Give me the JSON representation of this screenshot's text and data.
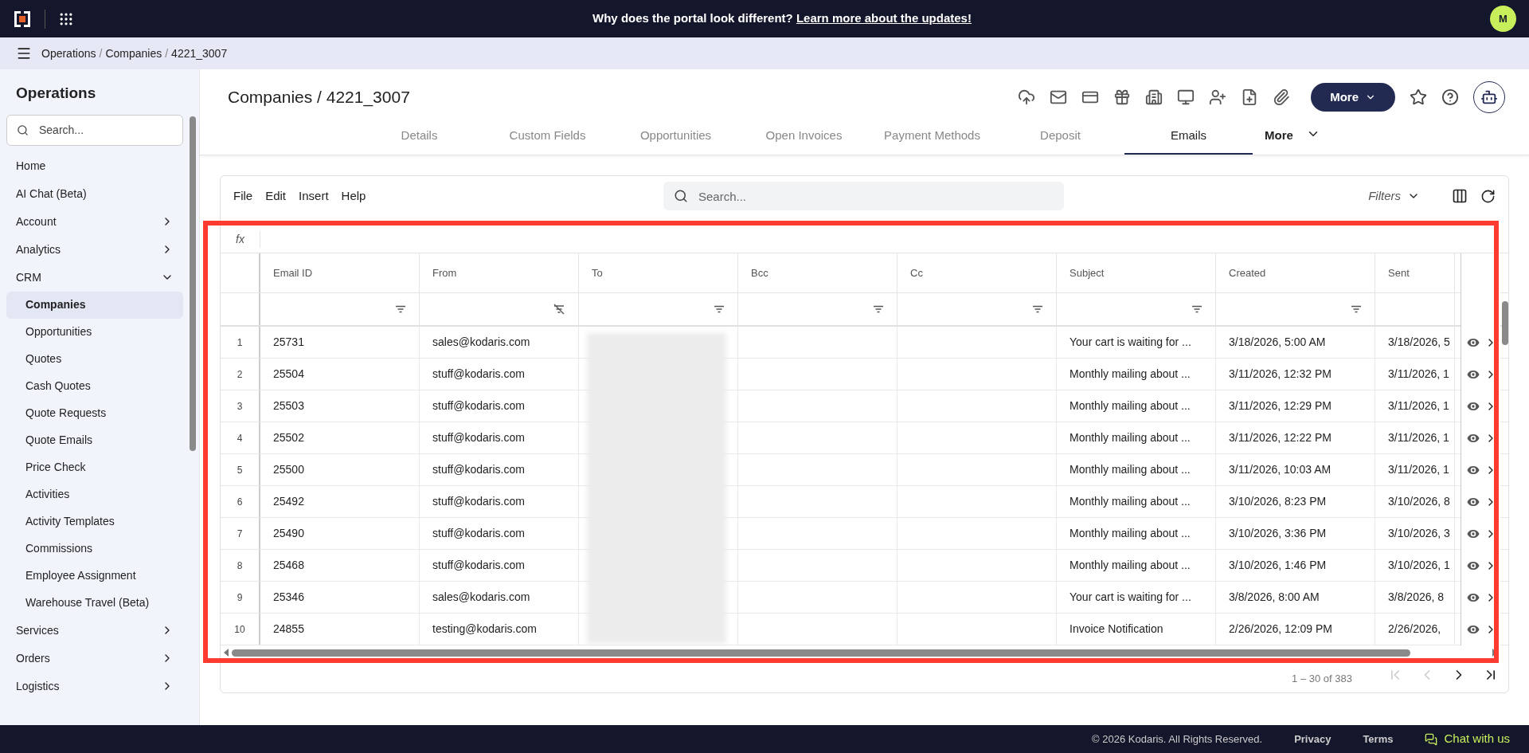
{
  "banner": {
    "text": "Why does the portal look different?",
    "link": "Learn more about the updates!",
    "avatar": "M"
  },
  "breadcrumb": {
    "separator": "/",
    "items": [
      "Operations",
      "Companies",
      "4221_3007"
    ]
  },
  "sidebar": {
    "title": "Operations",
    "search_placeholder": "Search...",
    "items": [
      {
        "label": "Home"
      },
      {
        "label": "AI Chat (Beta)"
      },
      {
        "label": "Account",
        "expanded": false
      },
      {
        "label": "Analytics",
        "expanded": false
      },
      {
        "label": "CRM",
        "expanded": true,
        "children": [
          {
            "label": "Companies",
            "selected": true
          },
          {
            "label": "Opportunities",
            "selected": false
          },
          {
            "label": "Quotes",
            "selected": false
          },
          {
            "label": "Cash Quotes",
            "selected": false
          },
          {
            "label": "Quote Requests",
            "selected": false
          },
          {
            "label": "Quote Emails",
            "selected": false
          },
          {
            "label": "Price Check",
            "selected": false
          },
          {
            "label": "Activities",
            "selected": false
          },
          {
            "label": "Activity Templates",
            "selected": false
          },
          {
            "label": "Commissions",
            "selected": false
          },
          {
            "label": "Employee Assignment",
            "selected": false
          },
          {
            "label": "Warehouse Travel (Beta)",
            "selected": false
          }
        ]
      },
      {
        "label": "Services",
        "expanded": false
      },
      {
        "label": "Orders",
        "expanded": false
      },
      {
        "label": "Logistics",
        "expanded": false
      }
    ]
  },
  "page": {
    "title": "Companies / 4221_3007",
    "more_button": "More"
  },
  "tabs": [
    {
      "label": "Details",
      "selected": false,
      "kind": "tab"
    },
    {
      "label": "Custom Fields",
      "selected": false,
      "kind": "tab"
    },
    {
      "label": "Opportunities",
      "selected": false,
      "kind": "tab"
    },
    {
      "label": "Open Invoices",
      "selected": false,
      "kind": "tab"
    },
    {
      "label": "Payment Methods",
      "selected": false,
      "kind": "tab"
    },
    {
      "label": "Deposit",
      "selected": false,
      "kind": "tab"
    },
    {
      "label": "Emails",
      "selected": true,
      "kind": "tab"
    },
    {
      "label": "More",
      "selected": false,
      "kind": "menu"
    }
  ],
  "grid": {
    "menu": [
      "File",
      "Edit",
      "Insert",
      "Help"
    ],
    "search_placeholder": "Search...",
    "filters": "Filters",
    "formula_label": "fx",
    "columns": [
      {
        "label": "Email ID",
        "filtered": false
      },
      {
        "label": "From",
        "filtered": true
      },
      {
        "label": "To",
        "filtered": false,
        "redacted": true
      },
      {
        "label": "Bcc",
        "filtered": false
      },
      {
        "label": "Cc",
        "filtered": false
      },
      {
        "label": "Subject",
        "filtered": false
      },
      {
        "label": "Created",
        "filtered": false
      },
      {
        "label": "Sent"
      }
    ],
    "rows": [
      {
        "n": "1",
        "cells": [
          "25731",
          "sales@kodaris.com",
          "",
          "",
          "",
          "Your cart is waiting for ...",
          "3/18/2026, 5:00 AM",
          "3/18/2026, 5"
        ]
      },
      {
        "n": "2",
        "cells": [
          "25504",
          "stuff@kodaris.com",
          "",
          "",
          "",
          "Monthly mailing about ...",
          "3/11/2026, 12:32 PM",
          "3/11/2026, 1"
        ]
      },
      {
        "n": "3",
        "cells": [
          "25503",
          "stuff@kodaris.com",
          "",
          "",
          "",
          "Monthly mailing about ...",
          "3/11/2026, 12:29 PM",
          "3/11/2026, 1"
        ]
      },
      {
        "n": "4",
        "cells": [
          "25502",
          "stuff@kodaris.com",
          "",
          "",
          "",
          "Monthly mailing about ...",
          "3/11/2026, 12:22 PM",
          "3/11/2026, 1"
        ]
      },
      {
        "n": "5",
        "cells": [
          "25500",
          "stuff@kodaris.com",
          "",
          "",
          "",
          "Monthly mailing about ...",
          "3/11/2026, 10:03 AM",
          "3/11/2026, 1"
        ]
      },
      {
        "n": "6",
        "cells": [
          "25492",
          "stuff@kodaris.com",
          "",
          "",
          "",
          "Monthly mailing about ...",
          "3/10/2026, 8:23 PM",
          "3/10/2026, 8"
        ]
      },
      {
        "n": "7",
        "cells": [
          "25490",
          "stuff@kodaris.com",
          "",
          "",
          "",
          "Monthly mailing about ...",
          "3/10/2026, 3:36 PM",
          "3/10/2026, 3"
        ]
      },
      {
        "n": "8",
        "cells": [
          "25468",
          "stuff@kodaris.com",
          "",
          "",
          "",
          "Monthly mailing about ...",
          "3/10/2026, 1:46 PM",
          "3/10/2026, 1"
        ]
      },
      {
        "n": "9",
        "cells": [
          "25346",
          "sales@kodaris.com",
          "",
          "",
          "",
          "Your cart is waiting for ...",
          "3/8/2026, 8:00 AM",
          "3/8/2026, 8"
        ]
      },
      {
        "n": "10",
        "cells": [
          "24855",
          "testing@kodaris.com",
          "",
          "",
          "",
          "Invoice Notification",
          "2/26/2026, 12:09 PM",
          "2/26/2026,"
        ]
      }
    ],
    "pagination": "1 – 30 of 383"
  },
  "footer": {
    "copyright": "© 2026 Kodaris. All Rights Reserved.",
    "links": [
      "Privacy",
      "Terms"
    ],
    "chat": "Chat with us"
  }
}
